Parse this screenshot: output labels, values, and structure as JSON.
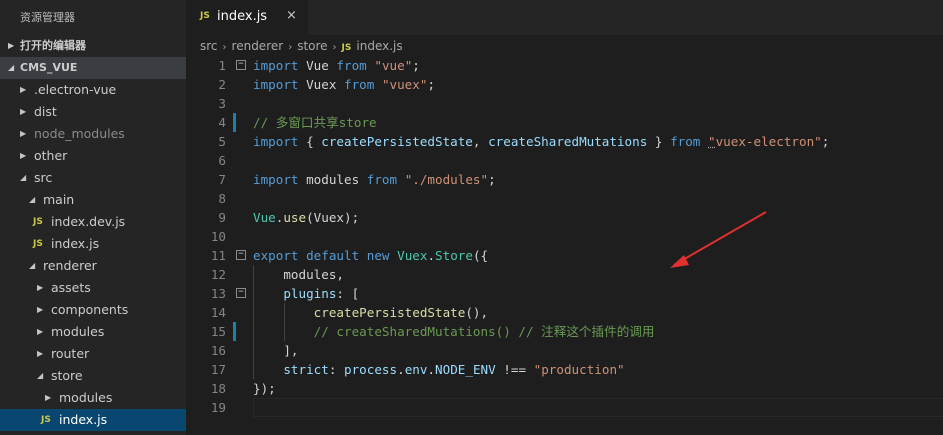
{
  "sidebar": {
    "title": "资源管理器",
    "open_editors_label": "打开的编辑器",
    "project_label": "CMS_VUE",
    "items": [
      {
        "label": ".electron-vue",
        "type": "folder",
        "expanded": false
      },
      {
        "label": "dist",
        "type": "folder",
        "expanded": false
      },
      {
        "label": "node_modules",
        "type": "folder",
        "expanded": false
      },
      {
        "label": "other",
        "type": "folder",
        "expanded": false
      },
      {
        "label": "src",
        "type": "folder",
        "expanded": true
      },
      {
        "label": "main",
        "type": "folder",
        "expanded": true
      },
      {
        "label": "index.dev.js",
        "type": "js-file"
      },
      {
        "label": "index.js",
        "type": "js-file"
      },
      {
        "label": "renderer",
        "type": "folder",
        "expanded": true
      },
      {
        "label": "assets",
        "type": "folder",
        "expanded": false
      },
      {
        "label": "components",
        "type": "folder",
        "expanded": false
      },
      {
        "label": "modules",
        "type": "folder",
        "expanded": false
      },
      {
        "label": "router",
        "type": "folder",
        "expanded": false
      },
      {
        "label": "store",
        "type": "folder",
        "expanded": true
      },
      {
        "label": "modules",
        "type": "folder",
        "expanded": false
      },
      {
        "label": "index.js",
        "type": "js-file",
        "selected": true
      }
    ]
  },
  "tab": {
    "icon": "JS",
    "filename": "index.js",
    "close_glyph": "×"
  },
  "breadcrumb": {
    "parts": [
      "src",
      "renderer",
      "store"
    ],
    "file_icon": "JS",
    "file": "index.js"
  },
  "code": {
    "line_numbers": [
      "1",
      "2",
      "3",
      "4",
      "5",
      "6",
      "7",
      "8",
      "9",
      "10",
      "11",
      "12",
      "13",
      "14",
      "15",
      "16",
      "17",
      "18",
      "19"
    ],
    "lines": [
      [
        {
          "t": "import",
          "c": "k"
        },
        {
          "t": " Vue ",
          "c": "p"
        },
        {
          "t": "from",
          "c": "k"
        },
        {
          "t": " ",
          "c": "p"
        },
        {
          "t": "\"vue\"",
          "c": "s"
        },
        {
          "t": ";",
          "c": "p"
        }
      ],
      [
        {
          "t": "import",
          "c": "k"
        },
        {
          "t": " Vuex ",
          "c": "p"
        },
        {
          "t": "from",
          "c": "k"
        },
        {
          "t": " ",
          "c": "p"
        },
        {
          "t": "\"vuex\"",
          "c": "s"
        },
        {
          "t": ";",
          "c": "p"
        }
      ],
      [],
      [
        {
          "t": "// 多窗口共享store",
          "c": "c"
        }
      ],
      [
        {
          "t": "import",
          "c": "k"
        },
        {
          "t": " { ",
          "c": "p"
        },
        {
          "t": "createPersistedState",
          "c": "v"
        },
        {
          "t": ", ",
          "c": "p"
        },
        {
          "t": "createSharedMutations",
          "c": "v"
        },
        {
          "t": " } ",
          "c": "p"
        },
        {
          "t": "from",
          "c": "k"
        },
        {
          "t": " ",
          "c": "p"
        },
        {
          "t": "\"",
          "c": "s sq"
        },
        {
          "t": "vuex-electron\"",
          "c": "s"
        },
        {
          "t": ";",
          "c": "p"
        }
      ],
      [],
      [
        {
          "t": "import",
          "c": "k"
        },
        {
          "t": " modules ",
          "c": "p"
        },
        {
          "t": "from",
          "c": "k"
        },
        {
          "t": " ",
          "c": "p"
        },
        {
          "t": "\"./modules\"",
          "c": "s"
        },
        {
          "t": ";",
          "c": "p"
        }
      ],
      [],
      [
        {
          "t": "Vue",
          "c": "t"
        },
        {
          "t": ".",
          "c": "p"
        },
        {
          "t": "use",
          "c": "f"
        },
        {
          "t": "(Vuex);",
          "c": "p"
        }
      ],
      [],
      [
        {
          "t": "export",
          "c": "k"
        },
        {
          "t": " ",
          "c": "p"
        },
        {
          "t": "default",
          "c": "k"
        },
        {
          "t": " ",
          "c": "p"
        },
        {
          "t": "new",
          "c": "k"
        },
        {
          "t": " ",
          "c": "p"
        },
        {
          "t": "Vuex",
          "c": "t"
        },
        {
          "t": ".",
          "c": "p"
        },
        {
          "t": "Store",
          "c": "t"
        },
        {
          "t": "({",
          "c": "p"
        }
      ],
      [
        {
          "t": "    modules,",
          "c": "p"
        }
      ],
      [
        {
          "t": "    ",
          "c": "p"
        },
        {
          "t": "plugins",
          "c": "v"
        },
        {
          "t": ": [",
          "c": "p"
        }
      ],
      [
        {
          "t": "        ",
          "c": "p"
        },
        {
          "t": "createPersistedState",
          "c": "f"
        },
        {
          "t": "(),",
          "c": "p"
        }
      ],
      [
        {
          "t": "        ",
          "c": "p"
        },
        {
          "t": "// createSharedMutations() // 注释这个插件的调用",
          "c": "c"
        }
      ],
      [
        {
          "t": "    ],",
          "c": "p"
        }
      ],
      [
        {
          "t": "    ",
          "c": "p"
        },
        {
          "t": "strict",
          "c": "v"
        },
        {
          "t": ": ",
          "c": "p"
        },
        {
          "t": "process",
          "c": "v"
        },
        {
          "t": ".",
          "c": "p"
        },
        {
          "t": "env",
          "c": "v"
        },
        {
          "t": ".",
          "c": "p"
        },
        {
          "t": "NODE_ENV",
          "c": "v"
        },
        {
          "t": " !== ",
          "c": "p"
        },
        {
          "t": "\"production\"",
          "c": "s"
        }
      ],
      [
        {
          "t": "});",
          "c": "p"
        }
      ],
      []
    ]
  },
  "colors": {
    "editor_bg": "#1e1e1e",
    "sidebar_bg": "#252526",
    "selection_bg": "#094771",
    "arrow": "#e03030"
  }
}
